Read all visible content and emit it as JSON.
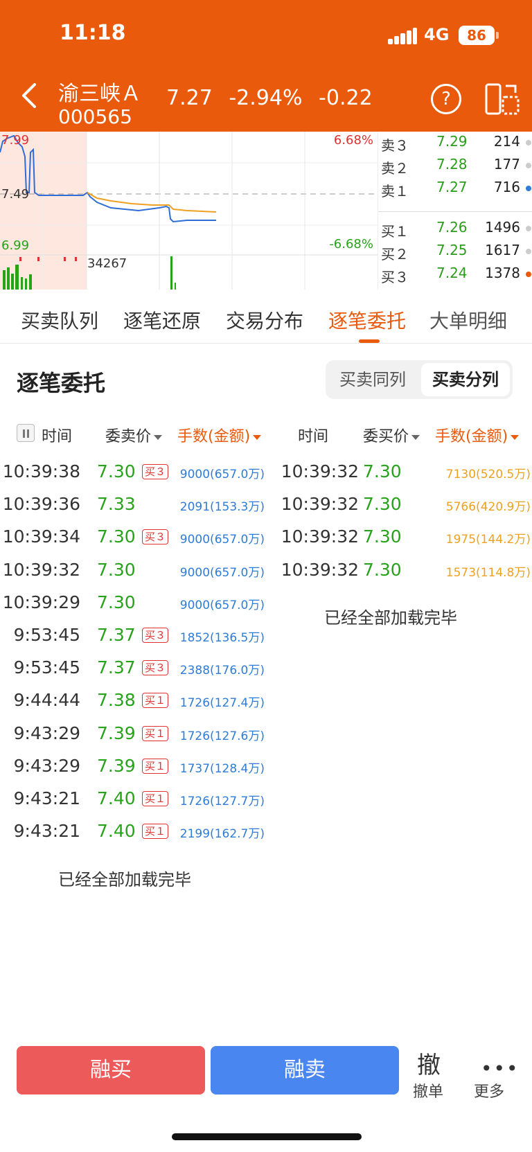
{
  "colors": {
    "brand": "#ea5a0c",
    "up": "#e03030",
    "down": "#27a31a",
    "volume_blue": "#2e7cd6",
    "volume_orange": "#f0a020"
  },
  "status_bar": {
    "time": "11:18",
    "network": "4G",
    "battery": "86"
  },
  "header": {
    "name": "渝三峡Ａ",
    "code": "000565",
    "price": "7.27",
    "change_pct": "-2.94%",
    "change": "-0.22",
    "help_icon": "?"
  },
  "chart": {
    "price_high": "7.99",
    "price_mid": "7.49",
    "price_low": "6.99",
    "pct_high": "6.68%",
    "pct_low": "-6.68%",
    "volume": "34267"
  },
  "orderbook": [
    {
      "label": "卖３",
      "price": "7.29",
      "volume": "214",
      "dot": "#cccccc"
    },
    {
      "label": "卖２",
      "price": "7.28",
      "volume": "177",
      "dot": "#cccccc"
    },
    {
      "label": "卖１",
      "price": "7.27",
      "volume": "716",
      "dot": "#2e7cd6"
    },
    {
      "label": "买１",
      "price": "7.26",
      "volume": "1496",
      "dot": "#cccccc"
    },
    {
      "label": "买２",
      "price": "7.25",
      "volume": "1617",
      "dot": "#cccccc"
    },
    {
      "label": "买３",
      "price": "7.24",
      "volume": "1378",
      "dot": "#ea5a0c"
    }
  ],
  "tabs": [
    "买卖队列",
    "逐笔还原",
    "交易分布",
    "逐笔委托",
    "大单明细"
  ],
  "active_tab": "逐笔委托",
  "section": {
    "title": "逐笔委托",
    "seg_same": "买卖同列",
    "seg_split": "买卖分列"
  },
  "columns": {
    "sell_time": "时间",
    "sell_price": "委卖价",
    "sell_volume": "手数(金额)",
    "buy_time": "时间",
    "buy_price": "委买价",
    "buy_volume": "手数(金额)"
  },
  "sell_rows": [
    {
      "time": "10:39:38",
      "price": "7.30",
      "tag": "买３",
      "volume": "9000(657.0万)"
    },
    {
      "time": "10:39:36",
      "price": "7.33",
      "tag": "",
      "volume": "2091(153.3万)"
    },
    {
      "time": "10:39:34",
      "price": "7.30",
      "tag": "买３",
      "volume": "9000(657.0万)"
    },
    {
      "time": "10:39:32",
      "price": "7.30",
      "tag": "",
      "volume": "9000(657.0万)"
    },
    {
      "time": "10:39:29",
      "price": "7.30",
      "tag": "",
      "volume": "9000(657.0万)"
    },
    {
      "time": "9:53:45",
      "price": "7.37",
      "tag": "买３",
      "volume": "1852(136.5万)"
    },
    {
      "time": "9:53:45",
      "price": "7.37",
      "tag": "买３",
      "volume": "2388(176.0万)"
    },
    {
      "time": "9:44:44",
      "price": "7.38",
      "tag": "买１",
      "volume": "1726(127.4万)"
    },
    {
      "time": "9:43:29",
      "price": "7.39",
      "tag": "买１",
      "volume": "1726(127.6万)"
    },
    {
      "time": "9:43:29",
      "price": "7.39",
      "tag": "买１",
      "volume": "1737(128.4万)"
    },
    {
      "time": "9:43:21",
      "price": "7.40",
      "tag": "买１",
      "volume": "1726(127.7万)"
    },
    {
      "time": "9:43:21",
      "price": "7.40",
      "tag": "买１",
      "volume": "2199(162.7万)"
    }
  ],
  "buy_rows": [
    {
      "time": "10:39:32",
      "price": "7.30",
      "volume": "7130(520.5万)"
    },
    {
      "time": "10:39:32",
      "price": "7.30",
      "volume": "5766(420.9万)"
    },
    {
      "time": "10:39:32",
      "price": "7.30",
      "volume": "1975(144.2万)"
    },
    {
      "time": "10:39:32",
      "price": "7.30",
      "volume": "1573(114.8万)"
    }
  ],
  "loaded_text_left": "已经全部加载完毕",
  "loaded_text_right": "已经全部加载完毕",
  "bottom": {
    "buy_label": "融买",
    "sell_label": "融卖",
    "cancel_glyph": "撤",
    "cancel_label": "撤单",
    "more_label": "更多"
  }
}
